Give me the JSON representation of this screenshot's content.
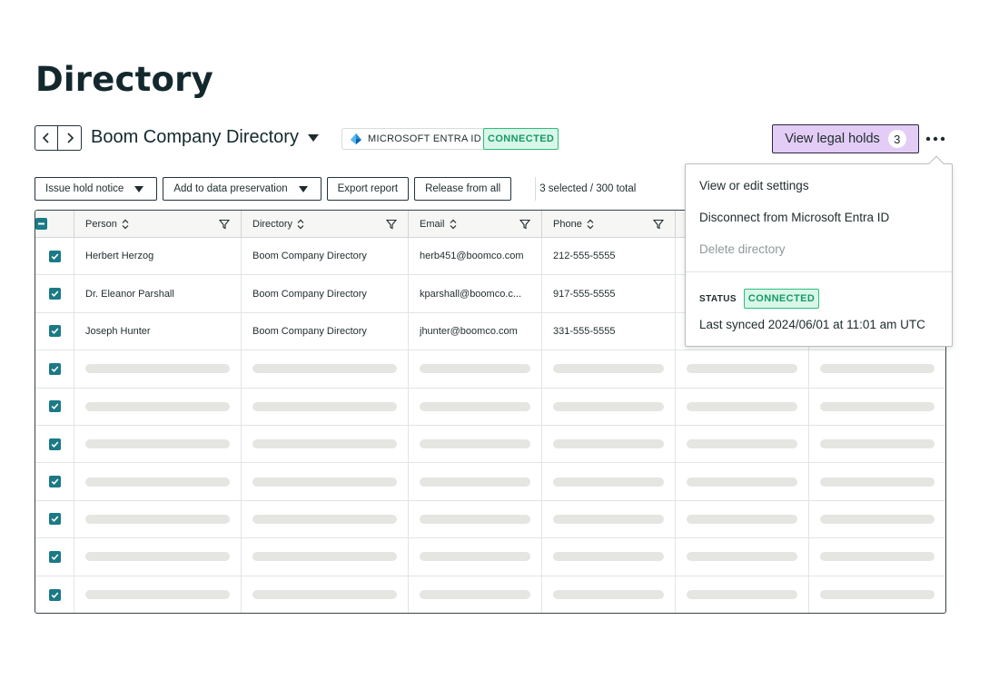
{
  "page": {
    "title": "Directory"
  },
  "header": {
    "directory_name": "Boom Company Directory",
    "integration_label": "MICROSOFT ENTRA ID",
    "status_badge": "CONNECTED",
    "legal_holds_label": "View legal holds",
    "legal_holds_count": "3"
  },
  "toolbar": {
    "issue_hold_notice": "Issue hold notice",
    "add_to_preservation": "Add to data preservation",
    "export_report": "Export report",
    "release_from_all": "Release from all",
    "selection_summary": "3 selected / 300 total"
  },
  "table": {
    "columns": [
      {
        "label": "Person"
      },
      {
        "label": "Directory"
      },
      {
        "label": "Email"
      },
      {
        "label": "Phone"
      }
    ],
    "rows": [
      {
        "person": "Herbert Herzog",
        "directory": "Boom Company Directory",
        "email": "herb451@boomco.com",
        "phone": "212-555-5555"
      },
      {
        "person": "Dr. Eleanor Parshall",
        "directory": "Boom Company Directory",
        "email": "kparshall@boomco.c...",
        "phone": "917-555-5555"
      },
      {
        "person": "Joseph Hunter",
        "directory": "Boom Company Directory",
        "email": "jhunter@boomco.com",
        "phone": "331-555-5555"
      }
    ],
    "loading_rows": 7
  },
  "menu": {
    "items": [
      {
        "label": "View or edit settings",
        "disabled": false
      },
      {
        "label": "Disconnect from Microsoft Entra ID",
        "disabled": false
      },
      {
        "label": "Delete directory",
        "disabled": true
      }
    ],
    "status_label": "STATUS",
    "status_value": "CONNECTED",
    "last_synced": "Last synced 2024/06/01 at 11:01 am UTC"
  },
  "colors": {
    "accent_teal": "#1a7a86",
    "legal_holds_bg": "#e3cdf6",
    "connected_green": "#2bbd7e",
    "skeleton": "#e5e5e2"
  },
  "icons": {
    "back": "chevron-left-icon",
    "forward": "chevron-right-icon",
    "dropdown": "caret-down-icon",
    "sort": "sort-icon",
    "filter": "filter-icon",
    "more": "more-horizontal-icon",
    "checkbox": "checkbox-checked-icon",
    "entra": "microsoft-entra-logo-icon"
  }
}
